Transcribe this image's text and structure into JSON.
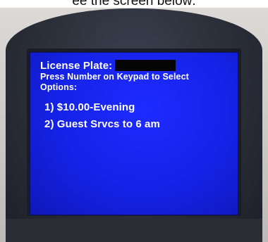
{
  "caption": "ee the screen below:",
  "screen": {
    "license_label": "License Plate:",
    "instructions_line1": "Press Number on Keypad to Select",
    "instructions_line2": "Options:",
    "options": [
      {
        "label": "1) $10.00-Evening"
      },
      {
        "label": "2) Guest Srvcs to 6 am"
      }
    ]
  },
  "colors": {
    "screen_background": "#1522e6",
    "screen_text": "#ffffff",
    "bezel": "#2a2e38",
    "redaction": "#050505"
  }
}
